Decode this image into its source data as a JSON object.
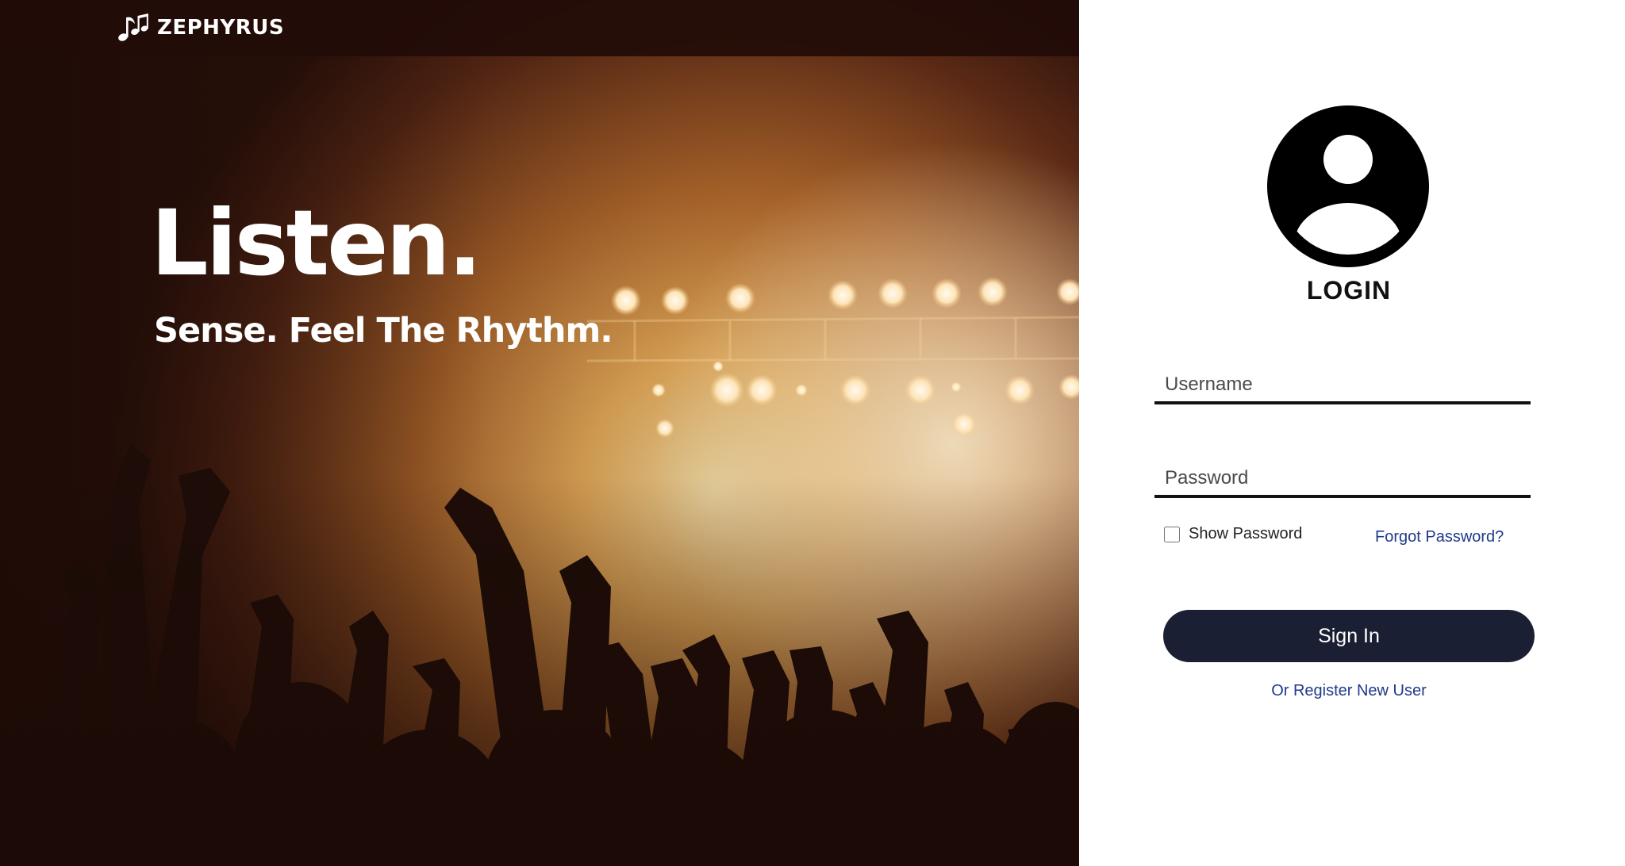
{
  "header": {
    "brand_name": "ZEPHYRUS",
    "brand_icon": "music-notes-icon"
  },
  "hero": {
    "title": "Listen.",
    "subtitle": "Sense. Feel The Rhythm.",
    "image": "concert-crowd-photo"
  },
  "login": {
    "avatar_icon": "user-avatar-icon",
    "heading": "LOGIN",
    "username": {
      "placeholder": "Username",
      "value": ""
    },
    "password": {
      "placeholder": "Password",
      "value": ""
    },
    "show_password_label": "Show Password",
    "show_password_checked": false,
    "forgot_password_label": "Forgot Password?",
    "signin_label": "Sign In",
    "register_label": "Or Register New User"
  },
  "colors": {
    "accent_button": "#1b1f33",
    "link": "#1f3a8a",
    "topbar": "#220c08",
    "hero_glow": "#f3b75e"
  }
}
